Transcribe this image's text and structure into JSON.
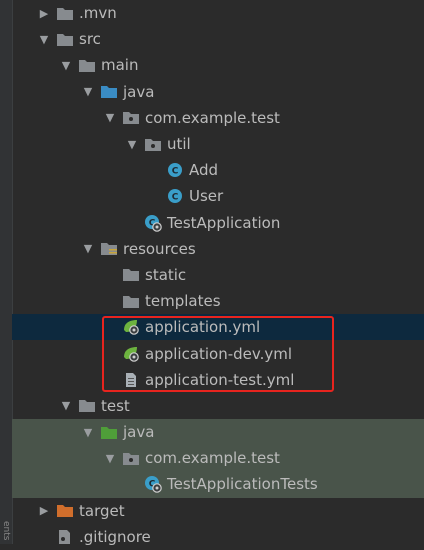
{
  "gutter": {
    "text": "ents"
  },
  "tree": [
    {
      "label": ".mvn",
      "icon": "folder-icon",
      "arrow": "collapsed",
      "depth": 0
    },
    {
      "label": "src",
      "icon": "folder-icon",
      "arrow": "expanded",
      "depth": 0
    },
    {
      "label": "main",
      "icon": "folder-icon",
      "arrow": "expanded",
      "depth": 1
    },
    {
      "label": "java",
      "icon": "source-folder-icon",
      "arrow": "expanded",
      "depth": 2
    },
    {
      "label": "com.example.test",
      "icon": "package-icon",
      "arrow": "expanded",
      "depth": 3
    },
    {
      "label": "util",
      "icon": "package-icon",
      "arrow": "expanded",
      "depth": 4
    },
    {
      "label": "Add",
      "icon": "class-icon",
      "arrow": "none",
      "depth": 5
    },
    {
      "label": "User",
      "icon": "class-icon",
      "arrow": "none",
      "depth": 5
    },
    {
      "label": "TestApplication",
      "icon": "spring-class-icon",
      "arrow": "none",
      "depth": 4
    },
    {
      "label": "resources",
      "icon": "resources-folder-icon",
      "arrow": "expanded",
      "depth": 2
    },
    {
      "label": "static",
      "icon": "folder-icon",
      "arrow": "none",
      "depth": 3
    },
    {
      "label": "templates",
      "icon": "folder-icon",
      "arrow": "none",
      "depth": 3
    },
    {
      "label": "application.yml",
      "icon": "spring-yml-icon",
      "arrow": "none",
      "depth": 3,
      "selected": true
    },
    {
      "label": "application-dev.yml",
      "icon": "spring-yml-icon",
      "arrow": "none",
      "depth": 3
    },
    {
      "label": "application-test.yml",
      "icon": "file-icon",
      "arrow": "none",
      "depth": 3
    },
    {
      "label": "test",
      "icon": "folder-icon",
      "arrow": "expanded",
      "depth": 1
    },
    {
      "label": "java",
      "icon": "test-folder-icon",
      "arrow": "expanded",
      "depth": 2,
      "testbg": true
    },
    {
      "label": "com.example.test",
      "icon": "package-icon",
      "arrow": "expanded",
      "depth": 3,
      "testbg": true
    },
    {
      "label": "TestApplicationTests",
      "icon": "spring-class-icon",
      "arrow": "none",
      "depth": 4,
      "testbg": true
    },
    {
      "label": "target",
      "icon": "excluded-folder-icon",
      "arrow": "collapsed",
      "depth": 0
    },
    {
      "label": ".gitignore",
      "icon": "gitignore-icon",
      "arrow": "none",
      "depth": 0
    }
  ],
  "colors": {
    "folder": "#878b8f",
    "source_folder": "#3a8cc4",
    "test_folder": "#4f9e39",
    "excluded_folder": "#d06e2c",
    "class": "#3a9ec9",
    "spring": "#6db33f",
    "highlight": "#e8241e"
  }
}
